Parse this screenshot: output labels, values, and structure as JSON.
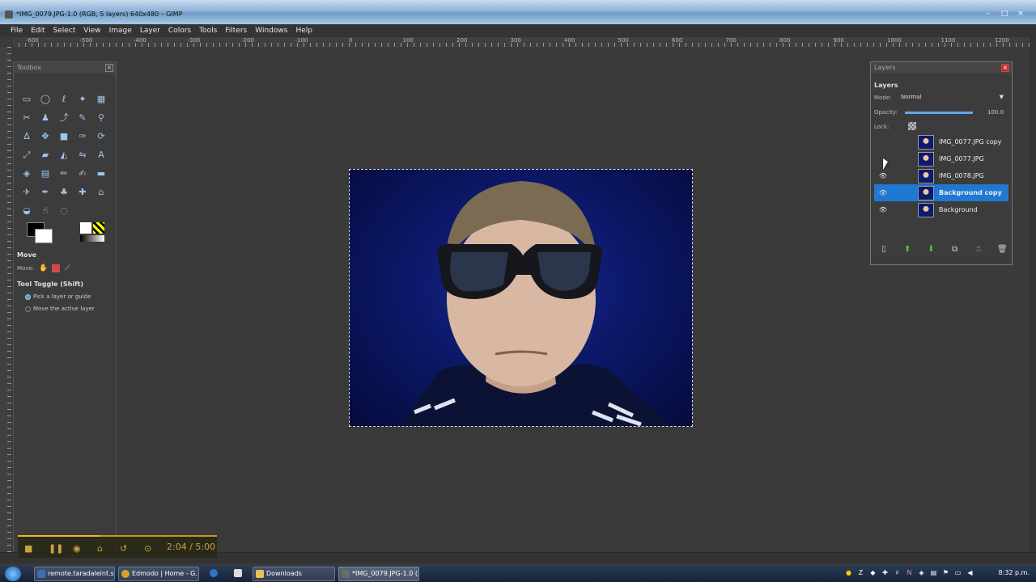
{
  "window": {
    "title": "*IMG_0079.JPG-1.0 (RGB, 5 layers) 640x480 – GIMP",
    "controls": [
      "–",
      "□",
      "×"
    ]
  },
  "menu": [
    "File",
    "Edit",
    "Select",
    "View",
    "Image",
    "Layer",
    "Colors",
    "Tools",
    "Filters",
    "Windows",
    "Help"
  ],
  "ruler_labels": [
    "-600",
    "-500",
    "-400",
    "-300",
    "-200",
    "-100",
    "0",
    "100",
    "200",
    "300",
    "400",
    "500",
    "600",
    "700",
    "800",
    "900",
    "1000",
    "1100",
    "1200"
  ],
  "toolbox": {
    "title": "Toolbox",
    "close": "×",
    "tools": [
      "rect-select",
      "ellipse-select",
      "free-select",
      "fuzzy-select",
      "select-by-color",
      "scissors-select",
      "foreground-select",
      "paths",
      "color-picker",
      "zoom",
      "measure",
      "move",
      "align",
      "crop",
      "rotate",
      "scale",
      "shear",
      "perspective",
      "flip",
      "text",
      "bucket-fill",
      "blend",
      "pencil",
      "paintbrush",
      "eraser",
      "airbrush",
      "ink",
      "clone",
      "heal",
      "perspective-clone",
      "blur-sharpen",
      "smudge",
      "dodge-burn"
    ],
    "options": {
      "title": "Move",
      "move_label": "Move:",
      "toggle_label": "Tool Toggle  (Shift)",
      "radio_1": "Pick a layer or guide",
      "radio_2": "Move the active layer"
    }
  },
  "layers": {
    "title": "Layers",
    "heading": "Layers",
    "mode_label": "Mode:",
    "mode_value": "Normal",
    "opacity_label": "Opacity:",
    "opacity_value": "100.0",
    "opacity_fraction": 1.0,
    "lock_label": "Lock:",
    "items": [
      {
        "name": "IMG_0077.JPG copy",
        "visible": false,
        "selected": false
      },
      {
        "name": "IMG_0077.JPG",
        "visible": false,
        "selected": false
      },
      {
        "name": "IMG_0078.JPG",
        "visible": true,
        "selected": false
      },
      {
        "name": "Background copy",
        "visible": true,
        "selected": true
      },
      {
        "name": "Background",
        "visible": true,
        "selected": false
      }
    ]
  },
  "video": {
    "time": "2:04 / 5:00",
    "progress_fraction": 0.41
  },
  "taskbar": {
    "tasks": [
      {
        "label": "remote.taradaleint.s...",
        "color": "#3a6fb8"
      },
      {
        "label": "Edmodo | Home - G...",
        "color": "#d8a323"
      },
      {
        "label": "Downloads",
        "color": "#e6c25a"
      },
      {
        "label": "*IMG_0079.JPG-1.0 (...",
        "color": "#6a6a6a"
      }
    ],
    "clock": "8:32 p.m."
  },
  "colors": {
    "accent": "#1f78d1",
    "background": "#3a3a3a"
  }
}
